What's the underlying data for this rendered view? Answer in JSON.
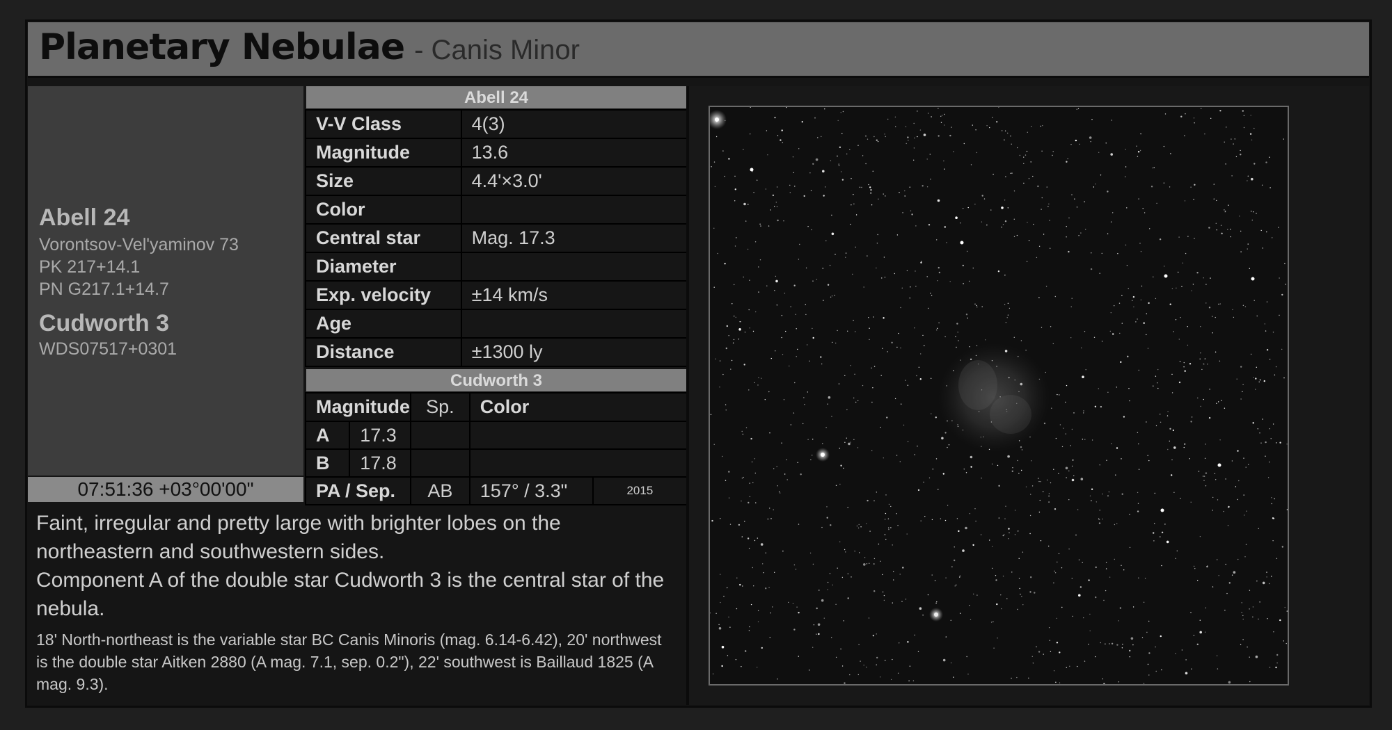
{
  "header": {
    "title": "Planetary Nebulae",
    "subtitle": "- Canis Minor"
  },
  "object": {
    "name": "Abell 24",
    "designations": [
      "Vorontsov-Vel'yaminov 73",
      "PK 217+14.1",
      "PN G217.1+14.7"
    ],
    "star_name": "Cudworth 3",
    "star_designation": "WDS07517+0301",
    "coordinates": "07:51:36 +03°00'00\""
  },
  "nebula_table": {
    "header": "Abell 24",
    "rows": [
      {
        "label": "V-V Class",
        "value": "4(3)"
      },
      {
        "label": "Magnitude",
        "value": "13.6"
      },
      {
        "label": "Size",
        "value": "4.4'×3.0'"
      },
      {
        "label": "Color",
        "value": ""
      },
      {
        "label": "Central star",
        "value": "Mag. 17.3"
      },
      {
        "label": "Diameter",
        "value": ""
      },
      {
        "label": "Exp. velocity",
        "value": "±14 km/s"
      },
      {
        "label": "Age",
        "value": ""
      },
      {
        "label": "Distance",
        "value": "±1300 ly"
      }
    ]
  },
  "star_table": {
    "header": "Cudworth 3",
    "col_magnitude": "Magnitude",
    "col_sp": "Sp.",
    "col_color": "Color",
    "components": [
      {
        "id": "A",
        "mag": "17.3",
        "sp": "",
        "color": ""
      },
      {
        "id": "B",
        "mag": "17.8",
        "sp": "",
        "color": ""
      }
    ],
    "pa_label": "PA / Sep.",
    "pa_pair": "AB",
    "pa_value": "157° / 3.3\"",
    "pa_year": "2015"
  },
  "description": {
    "main_1": "Faint, irregular and pretty large with brighter lobes on the northeastern and southwestern sides.",
    "main_2": "Component A of the double star Cudworth 3 is the central star of the nebula.",
    "note": "18' North-northeast is the variable star BC Canis Minoris (mag. 6.14-6.42), 20' northwest is the double star Aitken 2880 (A mag. 7.1, sep. 0.2\"), 22' southwest is Baillaud 1825 (A mag. 9.3)."
  }
}
